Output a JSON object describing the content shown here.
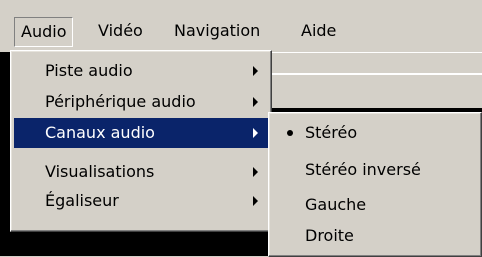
{
  "menubar": {
    "items": [
      {
        "label": "Audio"
      },
      {
        "label": "Vidéo"
      },
      {
        "label": "Navigation"
      },
      {
        "label": "Aide"
      }
    ]
  },
  "audio_menu": {
    "items": [
      {
        "label": "Piste audio"
      },
      {
        "label": "Périphérique audio"
      },
      {
        "label": "Canaux audio"
      },
      {
        "label": "Visualisations"
      },
      {
        "label": "Égaliseur"
      }
    ],
    "selected_item": "Canaux audio"
  },
  "channels_submenu": {
    "items": [
      {
        "label": "Stéréo"
      },
      {
        "label": "Stéréo inversé"
      },
      {
        "label": "Gauche"
      },
      {
        "label": "Droite"
      }
    ],
    "checked_item": "Stéréo"
  },
  "colors": {
    "menu_background": "#d4d0c8",
    "highlight": "#0a246a",
    "video_background": "#000000"
  }
}
